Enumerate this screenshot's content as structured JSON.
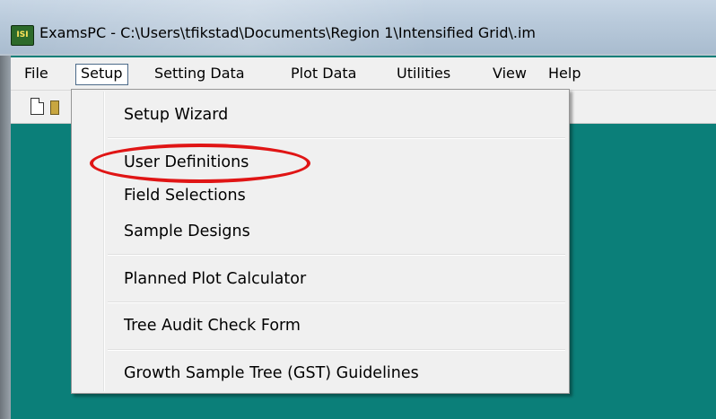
{
  "window": {
    "icon_label": "ISI",
    "title": "ExamsPC - C:\\Users\\tfikstad\\Documents\\Region 1\\Intensified Grid\\.im"
  },
  "menubar": {
    "items": [
      "File",
      "Setup",
      "Setting Data",
      "Plot Data",
      "Utilities",
      "View",
      "Help"
    ]
  },
  "setup_menu": {
    "items": [
      "Setup Wizard",
      "User Definitions",
      "Field Selections",
      "Sample Designs",
      "Planned Plot Calculator",
      "Tree Audit Check Form",
      "Growth Sample Tree (GST) Guidelines"
    ]
  },
  "colors": {
    "workspace": "#0b7f79",
    "highlight_ellipse": "#e01515",
    "menu_background": "#f0f0f0"
  }
}
